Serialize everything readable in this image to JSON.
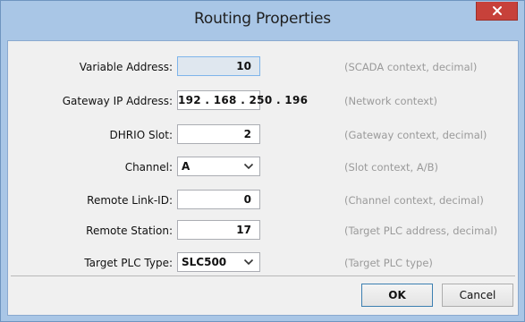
{
  "window": {
    "title": "Routing Properties",
    "close_glyph": "✕"
  },
  "form": {
    "rows": [
      {
        "label": "Variable Address:",
        "value": "10",
        "hint": "(SCADA context, decimal)"
      },
      {
        "label": "Gateway IP Address:",
        "value": "192 . 168 . 250 . 196",
        "hint": "(Network context)"
      },
      {
        "label": "DHRIO Slot:",
        "value": "2",
        "hint": "(Gateway context, decimal)"
      },
      {
        "label": "Channel:",
        "value": "A",
        "hint": "(Slot context, A/B)"
      },
      {
        "label": "Remote Link-ID:",
        "value": "0",
        "hint": "(Channel context, decimal)"
      },
      {
        "label": "Remote Station:",
        "value": "17",
        "hint": "(Target PLC address, decimal)"
      },
      {
        "label": "Target PLC Type:",
        "value": "SLC500",
        "hint": "(Target PLC type)"
      }
    ]
  },
  "buttons": {
    "ok_label": "OK",
    "cancel_label": "Cancel"
  },
  "colors": {
    "frame": "#a9c6e6",
    "close_button": "#c7413a",
    "hint_text": "#9a9a9a"
  },
  "icons": {
    "close": "close-icon",
    "dropdown": "chevron-down-icon"
  }
}
